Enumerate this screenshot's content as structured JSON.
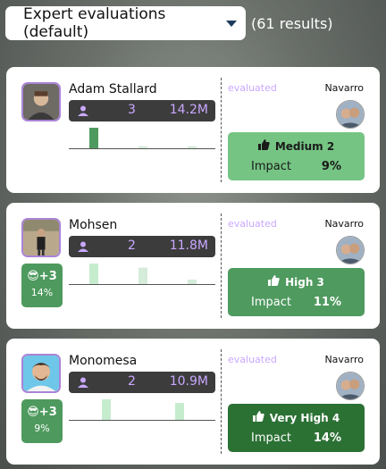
{
  "header": {
    "sort_label": "Expert evaluations (default)",
    "results_text": "(61 results)"
  },
  "colors": {
    "accent_purple": "#c9a8ff",
    "stats_bg": "#3c3c3c",
    "impact_medium": "#75c483",
    "impact_high": "#4f9a5f",
    "impact_very_high": "#2b7134"
  },
  "cards": [
    {
      "name": "Adam Stallard",
      "count": "3",
      "value": "14.2M",
      "evaluated_label": "evaluated",
      "evaluator": "Navarro",
      "impact_level": "Medium 2",
      "impact_label": "Impact",
      "impact_pct": "9%",
      "bars": [
        1.0,
        0.1,
        0.1
      ],
      "bar_colors": [
        "#4e9a5e",
        "#d4ecd9",
        "#d4ecd9"
      ]
    },
    {
      "name": "Mohsen",
      "count": "2",
      "value": "11.8M",
      "badge_top": "+3",
      "badge_pct": "14%",
      "evaluated_label": "evaluated",
      "evaluator": "Navarro",
      "impact_level": "High 3",
      "impact_label": "Impact",
      "impact_pct": "11%",
      "bars": [
        1.0,
        0.8,
        0.22
      ],
      "bar_colors": [
        "#c6ecce",
        "#d4ecd9",
        "#d4ecd9"
      ]
    },
    {
      "name": "Monomesa",
      "count": "2",
      "value": "10.9M",
      "badge_top": "+3",
      "badge_pct": "9%",
      "evaluated_label": "evaluated",
      "evaluator": "Navarro",
      "impact_level": "Very High 4",
      "impact_label": "Impact",
      "impact_pct": "14%",
      "bars": [
        1.0,
        0.82
      ],
      "bar_colors": [
        "#c6ecce",
        "#c6ecce"
      ]
    }
  ],
  "icons": {
    "sort": "chevron-down-icon",
    "person": "person-icon",
    "thumb": "thumbs-up-icon",
    "badge": "sunglasses-emoji-icon"
  }
}
